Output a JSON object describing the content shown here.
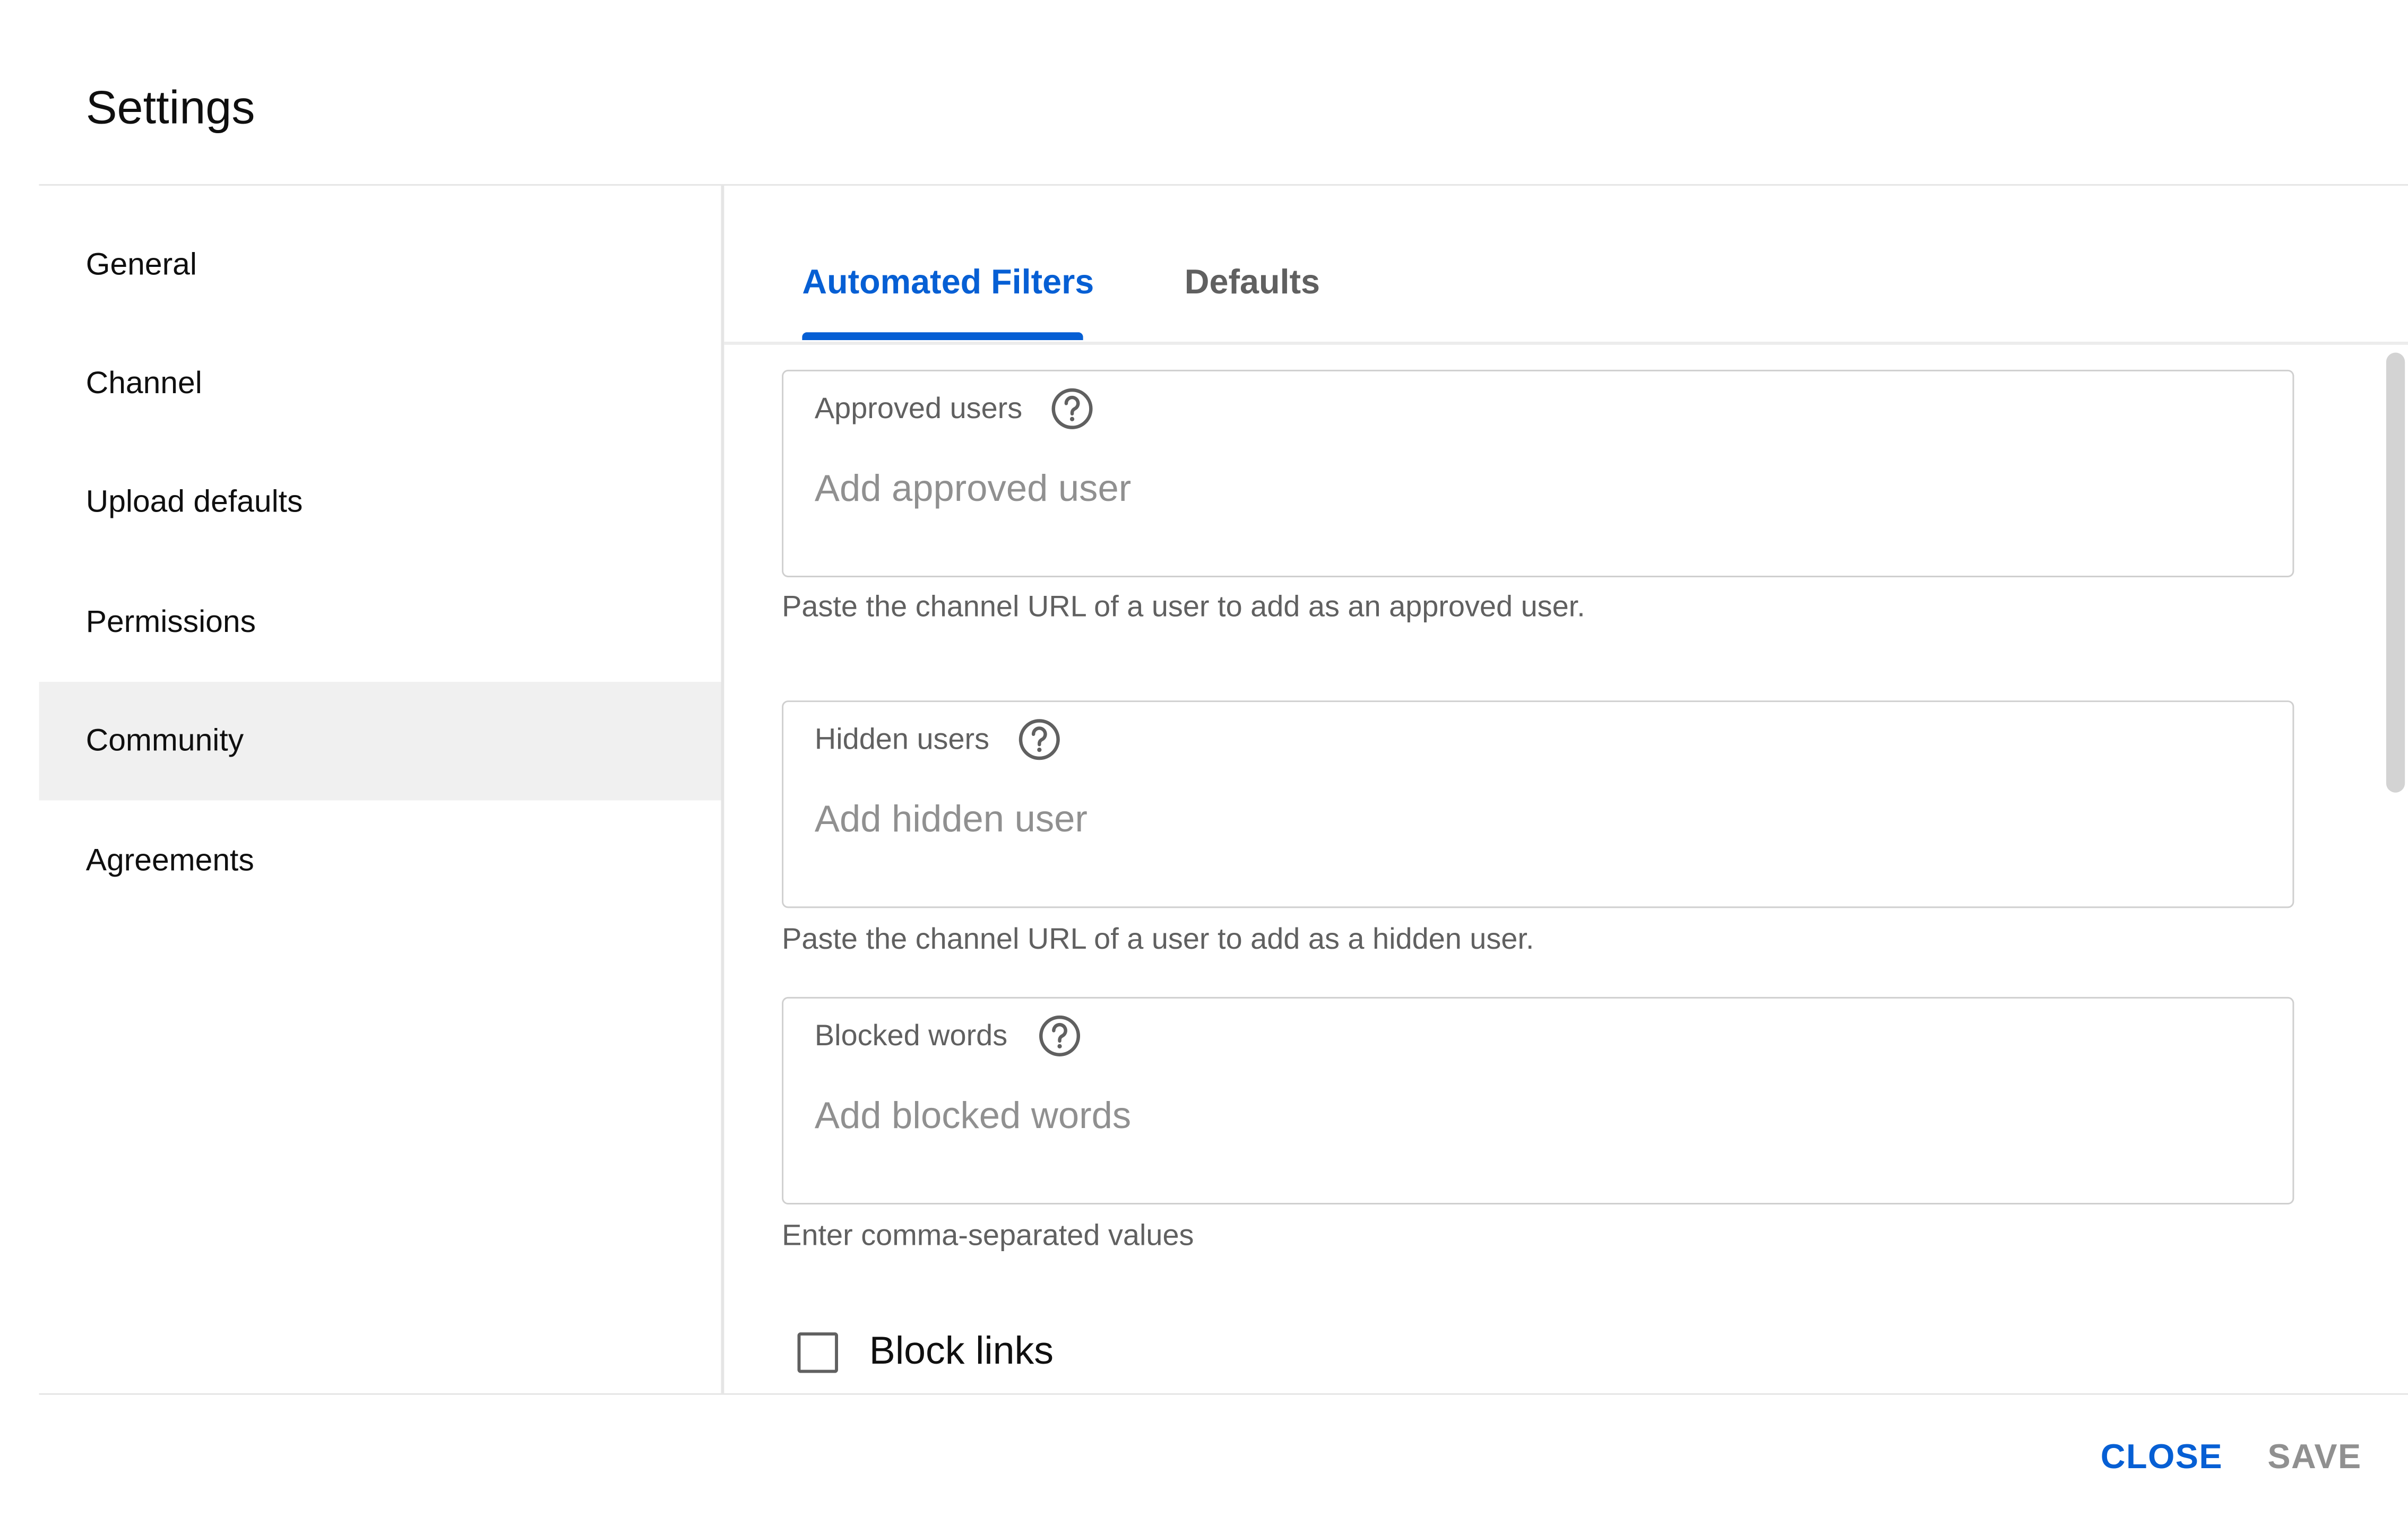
{
  "dialog": {
    "title": "Settings"
  },
  "sidebar": {
    "items": [
      {
        "label": "General"
      },
      {
        "label": "Channel"
      },
      {
        "label": "Upload defaults"
      },
      {
        "label": "Permissions"
      },
      {
        "label": "Community",
        "selected": true
      },
      {
        "label": "Agreements"
      }
    ]
  },
  "tabs": [
    {
      "label": "Automated Filters",
      "selected": true
    },
    {
      "label": "Defaults"
    }
  ],
  "filters": {
    "approved_users": {
      "label": "Approved users",
      "placeholder": "Add approved user",
      "value": "",
      "helper": "Paste the channel URL of a user to add as an approved user."
    },
    "hidden_users": {
      "label": "Hidden users",
      "placeholder": "Add hidden user",
      "value": "",
      "helper": "Paste the channel URL of a user to add as a hidden user."
    },
    "blocked_words": {
      "label": "Blocked words",
      "placeholder": "Add blocked words",
      "value": "",
      "helper": "Enter comma-separated values"
    },
    "block_links": {
      "label": "Block links",
      "checked": false
    }
  },
  "footer": {
    "close_label": "CLOSE",
    "save_label": "SAVE"
  },
  "colors": {
    "accent": "#065fd4",
    "selected_nav_bg": "#f0f0f0",
    "disabled_text": "#909090"
  },
  "icons": {
    "help": "help-circle-icon"
  }
}
